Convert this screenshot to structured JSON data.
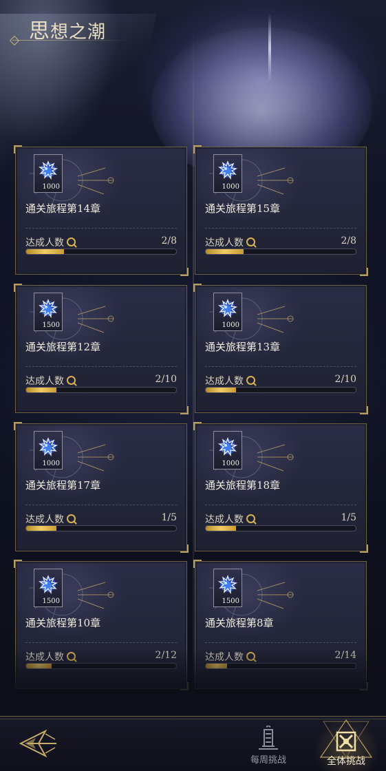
{
  "header": {
    "title_first_char": "思",
    "title_rest": "想之潮"
  },
  "cards": [
    {
      "item_count": "1000",
      "title": "通关旅程第14章",
      "progress_label": "达成人数",
      "progress_value": "2/8",
      "progress_fraction": 0.25
    },
    {
      "item_count": "1000",
      "title": "通关旅程第15章",
      "progress_label": "达成人数",
      "progress_value": "2/8",
      "progress_fraction": 0.25
    },
    {
      "item_count": "1500",
      "title": "通关旅程第12章",
      "progress_label": "达成人数",
      "progress_value": "2/10",
      "progress_fraction": 0.2
    },
    {
      "item_count": "1000",
      "title": "通关旅程第13章",
      "progress_label": "达成人数",
      "progress_value": "2/10",
      "progress_fraction": 0.2
    },
    {
      "item_count": "1000",
      "title": "通关旅程第17章",
      "progress_label": "达成人数",
      "progress_value": "1/5",
      "progress_fraction": 0.2
    },
    {
      "item_count": "1000",
      "title": "通关旅程第18章",
      "progress_label": "达成人数",
      "progress_value": "1/5",
      "progress_fraction": 0.2
    },
    {
      "item_count": "1500",
      "title": "通关旅程第10章",
      "progress_label": "达成人数",
      "progress_value": "2/12",
      "progress_fraction": 0.17
    },
    {
      "item_count": "1500",
      "title": "通关旅程第8章",
      "progress_label": "达成人数",
      "progress_value": "2/14",
      "progress_fraction": 0.14
    }
  ],
  "bottom_nav": {
    "weekly_label": "每周挑战",
    "all_label": "全体挑战"
  },
  "colors": {
    "accent_gold": "#d8b354",
    "card_border": "#6d6146",
    "background": "#0d0f18"
  },
  "icons": [
    "gem-icon",
    "search-icon",
    "back-arrow-icon",
    "weekly-tower-icon",
    "all-challenge-icon"
  ]
}
